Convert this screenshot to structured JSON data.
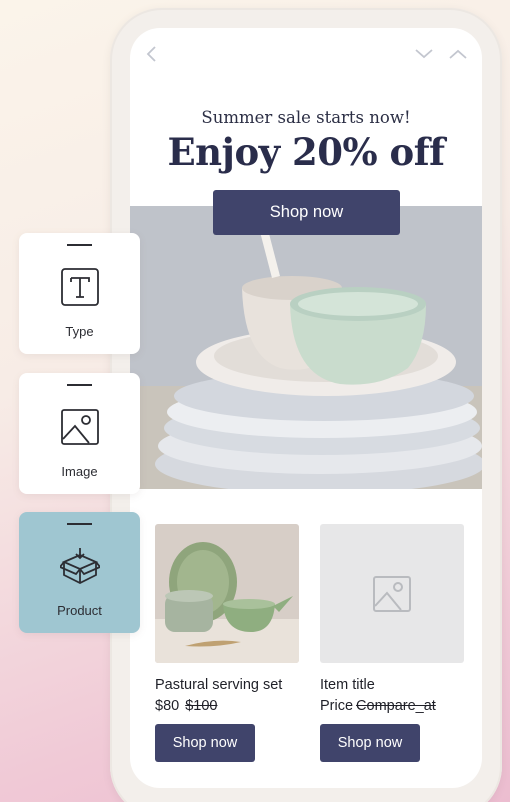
{
  "email": {
    "eyebrow": "Summer sale starts now!",
    "headline": "Enjoy 20% off",
    "hero_button_label": "Shop now",
    "products": [
      {
        "title": "Pastural serving set",
        "price": "$80",
        "compare_at": "$100",
        "button_label": "Shop now"
      },
      {
        "title": "Item title",
        "price": "Price",
        "compare_at": "Compare_at",
        "button_label": "Shop now"
      }
    ]
  },
  "blocks": [
    {
      "label": "Type",
      "icon": "text-type-icon",
      "active": false
    },
    {
      "label": "Image",
      "icon": "image-icon",
      "active": false
    },
    {
      "label": "Product",
      "icon": "product-box-icon",
      "active": true
    }
  ],
  "colors": {
    "button": "#40446b",
    "headline": "#2a2d4b",
    "active_tile": "#9fc6d1",
    "placeholder": "#e7e7e8"
  }
}
